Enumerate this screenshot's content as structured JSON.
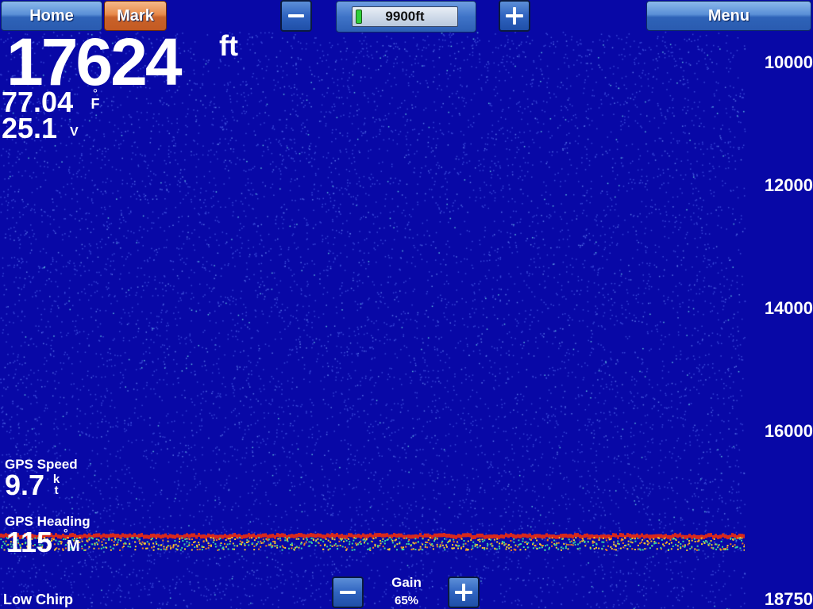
{
  "toolbar": {
    "home_label": "Home",
    "mark_label": "Mark",
    "range_value": "9900ft",
    "menu_label": "Menu"
  },
  "readouts": {
    "depth_value": "17624",
    "depth_unit": "ft",
    "temperature_value": "77.04",
    "temperature_degree": "°",
    "temperature_unit": "F",
    "voltage_value": "25.1",
    "voltage_unit": "V"
  },
  "gps": {
    "speed_label": "GPS Speed",
    "speed_value": "9.7",
    "speed_unit": "kt",
    "heading_label": "GPS Heading",
    "heading_value": "115",
    "heading_degree": "°",
    "heading_unit": "M"
  },
  "frequency_label": "Low Chirp",
  "gain": {
    "title": "Gain",
    "value": "65%"
  },
  "depth_scale": [
    "10000",
    "12000",
    "14000",
    "16000",
    "18750"
  ],
  "colors": {
    "water_background": "#0808a6",
    "button_blue": "#2e63b8",
    "button_orange": "#c9622a",
    "range_indicator": "#2fd03a",
    "bottom_return_strong": "#d8281c",
    "bottom_return_medium": "#f2c830",
    "bottom_return_weak": "#38d0a0"
  },
  "icons": {
    "range_minus": "minus-icon",
    "range_plus": "plus-icon",
    "gain_minus": "minus-icon",
    "gain_plus": "plus-icon"
  }
}
